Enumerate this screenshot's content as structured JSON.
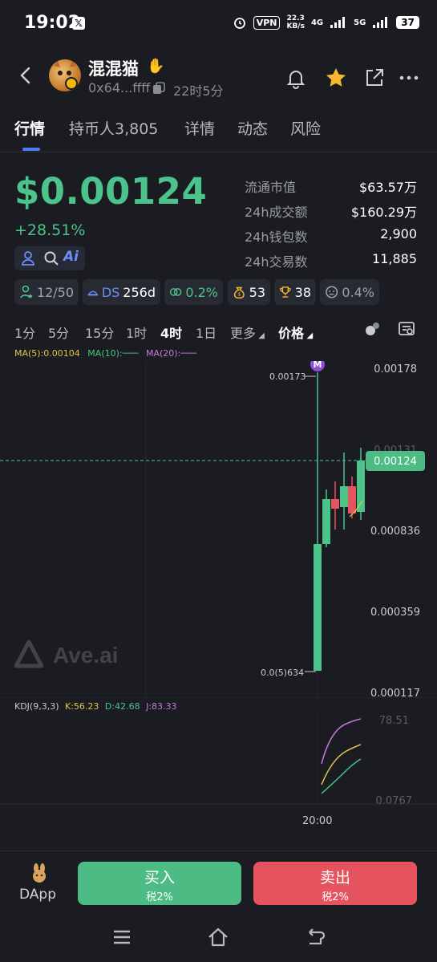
{
  "status_bar": {
    "time": "19:02",
    "x_badge": "𝕏",
    "vpn": "VPN",
    "net_speed_value": "22.3",
    "net_speed_unit": "KB/s",
    "sig1": "4G",
    "sig2": "5G",
    "battery": "37"
  },
  "header": {
    "token_name": "混混猫",
    "address": "0x64...ffff",
    "age": "22时5分"
  },
  "tabs": [
    {
      "label": "行情"
    },
    {
      "label": "持币人3,805"
    },
    {
      "label": "详情"
    },
    {
      "label": "动态"
    },
    {
      "label": "风险"
    }
  ],
  "price": {
    "value": "$0.00124",
    "change": "+28.51%"
  },
  "stats": [
    {
      "key": "流通市值",
      "value": "$63.57万"
    },
    {
      "key": "24h成交额",
      "value": "$160.29万"
    },
    {
      "key": "24h钱包数",
      "value": "2,900"
    },
    {
      "key": "24h交易数",
      "value": "11,885"
    }
  ],
  "badges": {
    "holders_ratio": "12/50",
    "ds_label": "DS",
    "ds_days": "256d",
    "swap_pct": "0.2%",
    "bag_count": "53",
    "trophy_count": "38",
    "face_pct": "0.4%"
  },
  "timeframes": {
    "items": [
      "1分",
      "5分",
      "15分",
      "1时",
      "4时",
      "1日"
    ],
    "active": "4时",
    "more": "更多",
    "price": "价格"
  },
  "ma_legend": {
    "ma5": "MA(5):0.00104",
    "ma10": "MA(10):",
    "ma20": "MA(20):"
  },
  "kdj_legend": {
    "label": "KDJ(9,3,3)",
    "k": "K:56.23",
    "d": "D:42.68",
    "j": "J:83.33"
  },
  "chart_data": {
    "type": "candlestick",
    "y_axis_ticks": [
      "0.00178",
      "0.00131",
      "0.000836",
      "0.000359",
      "0.000117"
    ],
    "current_price_label": "0.00124",
    "high_label": "0.00173",
    "low_label": "0.0(5)634",
    "marker": "M",
    "watermark": "Ave.ai",
    "x_axis_ticks": [
      "20:00"
    ],
    "kdj_axis_ticks": [
      "78.51",
      "0.0767"
    ],
    "colors": {
      "up": "#4cc38a",
      "down": "#e5535f",
      "ma5": "#e0c64a",
      "ma10": "#4cc38a",
      "ma20": "#c678dd"
    }
  },
  "bottom": {
    "dapp": "DApp",
    "buy_label": "买入",
    "buy_tax": "税2%",
    "sell_label": "卖出",
    "sell_tax": "税2%"
  }
}
